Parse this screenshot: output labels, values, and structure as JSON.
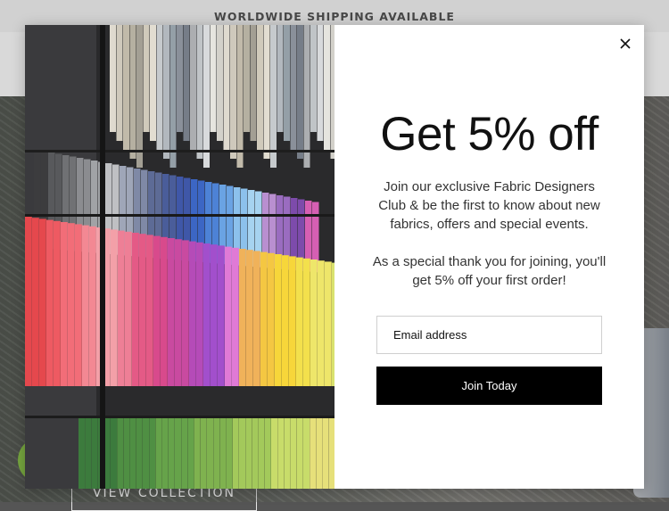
{
  "announcement": {
    "text": "WORLDWIDE SHIPPING AVAILABLE"
  },
  "hero": {
    "button_label": "VIEW COLLECTION"
  },
  "popup": {
    "title": "Get 5% off",
    "intro": "Join our exclusive Fabric Designers Club & be the first to know about new fabrics, offers and special events.",
    "thanks": "As a special thank you for joining, you'll get 5% off your first order!",
    "email_placeholder": "Email address",
    "submit_label": "Join Today",
    "close_icon": "close-icon"
  },
  "colors": {
    "announcement_bg": "#f6f6f6",
    "button_bg": "#000000",
    "chat_green": "#8bc34a"
  }
}
